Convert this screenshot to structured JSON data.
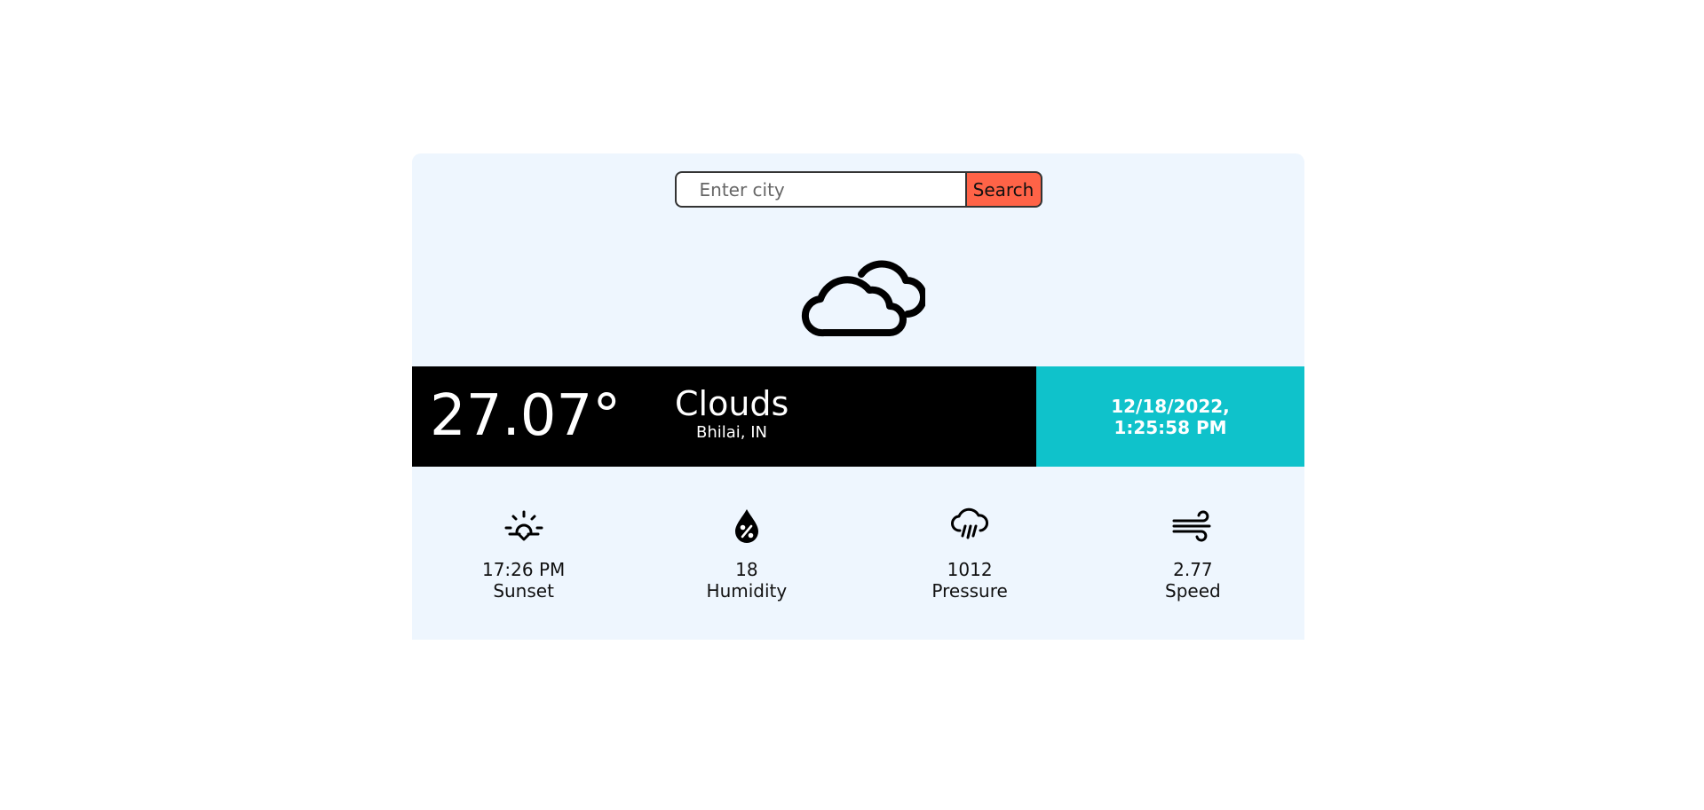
{
  "search": {
    "placeholder": "Enter city",
    "button_label": "Search",
    "button_color": "#ff6347"
  },
  "weather": {
    "icon": "clouds-icon",
    "temperature": "27.07°",
    "condition": "Clouds",
    "location": "Bhilai, IN"
  },
  "datetime": "12/18/2022, 1:25:58 PM",
  "stats": [
    {
      "icon": "sunset-icon",
      "value": "17:26 PM",
      "label": "Sunset"
    },
    {
      "icon": "humidity-icon",
      "value": "18",
      "label": "Humidity"
    },
    {
      "icon": "pressure-icon",
      "value": "1012",
      "label": "Pressure"
    },
    {
      "icon": "wind-icon",
      "value": "2.77",
      "label": "Speed"
    }
  ],
  "colors": {
    "card_background": "#eef6fe",
    "info_bar_left": "#000000",
    "info_bar_right": "#0fc2cb"
  }
}
